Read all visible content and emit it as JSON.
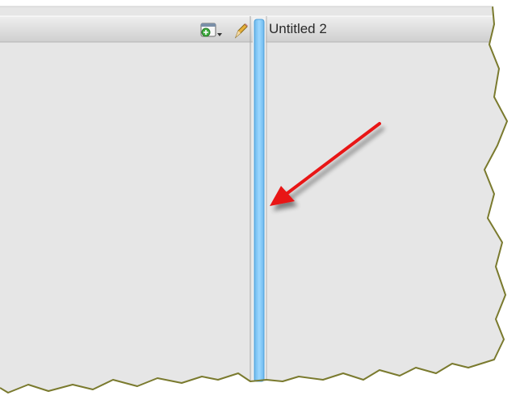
{
  "right_pane": {
    "title": "Untitled 2"
  },
  "left_pane": {
    "toolbar": {
      "page_icon": "add-page-icon",
      "dropdown_icon": "chevron-down-icon",
      "edit_icon": "pencil-icon"
    }
  },
  "divider": {
    "name": "pane-splitter",
    "highlight_color": "#8fd0ff"
  },
  "annotation": {
    "arrow_color": "#e81818"
  }
}
